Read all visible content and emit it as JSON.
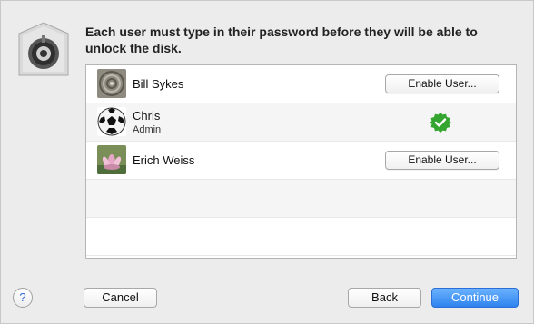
{
  "dialog": {
    "message": "Each user must type in their password before they will be able to unlock the disk."
  },
  "users": [
    {
      "name": "Bill Sykes",
      "role": "",
      "action": "Enable User...",
      "enabled": false,
      "avatar": "stone-spiral-avatar"
    },
    {
      "name": "Chris",
      "role": "Admin",
      "action": "",
      "enabled": true,
      "avatar": "soccer-ball-avatar"
    },
    {
      "name": "Erich Weiss",
      "role": "",
      "action": "Enable User...",
      "enabled": false,
      "avatar": "lotus-flower-avatar"
    }
  ],
  "buttons": {
    "help": "?",
    "cancel": "Cancel",
    "back": "Back",
    "continue": "Continue"
  },
  "colors": {
    "accent": "#2f83ef",
    "check": "#34a52f"
  }
}
